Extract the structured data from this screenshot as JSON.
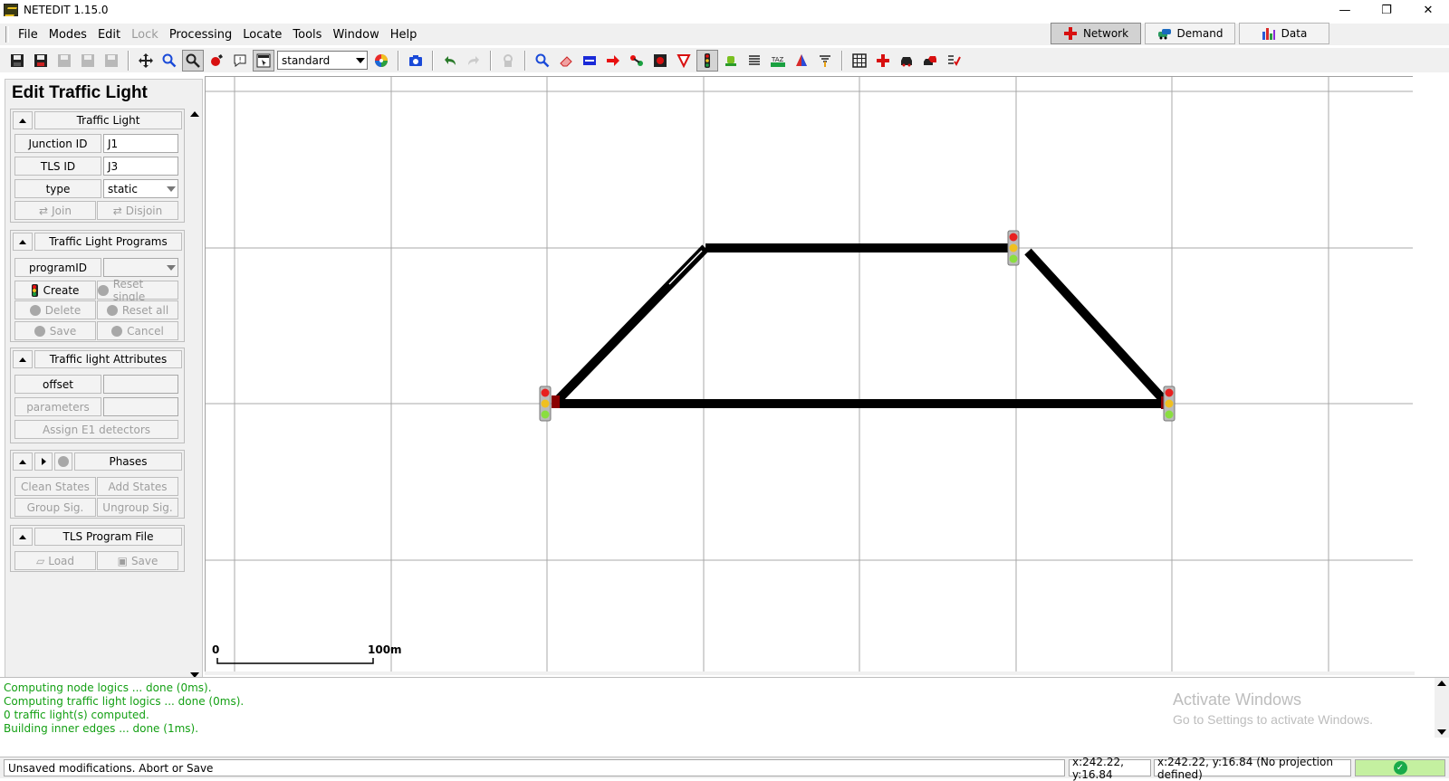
{
  "window": {
    "title": "NETEDIT 1.15.0",
    "controls": {
      "minimize": "—",
      "restore": "❐",
      "close": "✕"
    }
  },
  "menubar": {
    "items": [
      {
        "label": "File",
        "enabled": true
      },
      {
        "label": "Modes",
        "enabled": true
      },
      {
        "label": "Edit",
        "enabled": true
      },
      {
        "label": "Lock",
        "enabled": false
      },
      {
        "label": "Processing",
        "enabled": true
      },
      {
        "label": "Locate",
        "enabled": true
      },
      {
        "label": "Tools",
        "enabled": true
      },
      {
        "label": "Window",
        "enabled": true
      },
      {
        "label": "Help",
        "enabled": true
      }
    ]
  },
  "supermodes": {
    "network": "Network",
    "demand": "Demand",
    "data": "Data",
    "active": "Network"
  },
  "toolbar": {
    "scheme_value": "standard"
  },
  "side_panel": {
    "title": "Edit Traffic Light",
    "traffic_light": {
      "header": "Traffic Light",
      "junction_id_label": "Junction ID",
      "junction_id_value": "J1",
      "tls_id_label": "TLS ID",
      "tls_id_value": "J3",
      "type_label": "type",
      "type_value": "static",
      "join_label": "Join",
      "disjoin_label": "Disjoin"
    },
    "programs": {
      "header": "Traffic Light Programs",
      "program_id_label": "programID",
      "program_id_value": "",
      "create_label": "Create",
      "reset_single_label": "Reset single",
      "delete_label": "Delete",
      "reset_all_label": "Reset all",
      "save_label": "Save",
      "cancel_label": "Cancel"
    },
    "attributes": {
      "header": "Traffic light Attributes",
      "offset_label": "offset",
      "offset_value": "",
      "parameters_label": "parameters",
      "parameters_value": "",
      "assign_e1_label": "Assign E1 detectors"
    },
    "phases": {
      "header": "Phases",
      "clean_states_label": "Clean States",
      "add_states_label": "Add States",
      "group_sig_label": "Group Sig.",
      "ungroup_sig_label": "Ungroup Sig."
    },
    "program_file": {
      "header": "TLS Program File",
      "load_label": "Load",
      "save_label": "Save"
    }
  },
  "canvas": {
    "scale_bar": {
      "start_label": "0",
      "end_label": "100m"
    }
  },
  "console": {
    "lines": [
      "Computing node logics ... done (0ms).",
      "Computing traffic light logics ... done (0ms).",
      " 0 traffic light(s) computed.",
      "Building inner edges ... done (1ms)."
    ],
    "watermark_title": "Activate Windows",
    "watermark_subtitle": "Go to Settings to activate Windows."
  },
  "statusbar": {
    "message": "Unsaved modifications. Abort or Save",
    "cursor_coords": "x:242.22, y:16.84",
    "geo_coords": "x:242.22, y:16.84 (No projection defined)"
  },
  "colors": {
    "console_text": "#14a014",
    "status_ok_bg": "#c4f0a0",
    "edge": "#000000",
    "grid": "#a8a8a8"
  }
}
